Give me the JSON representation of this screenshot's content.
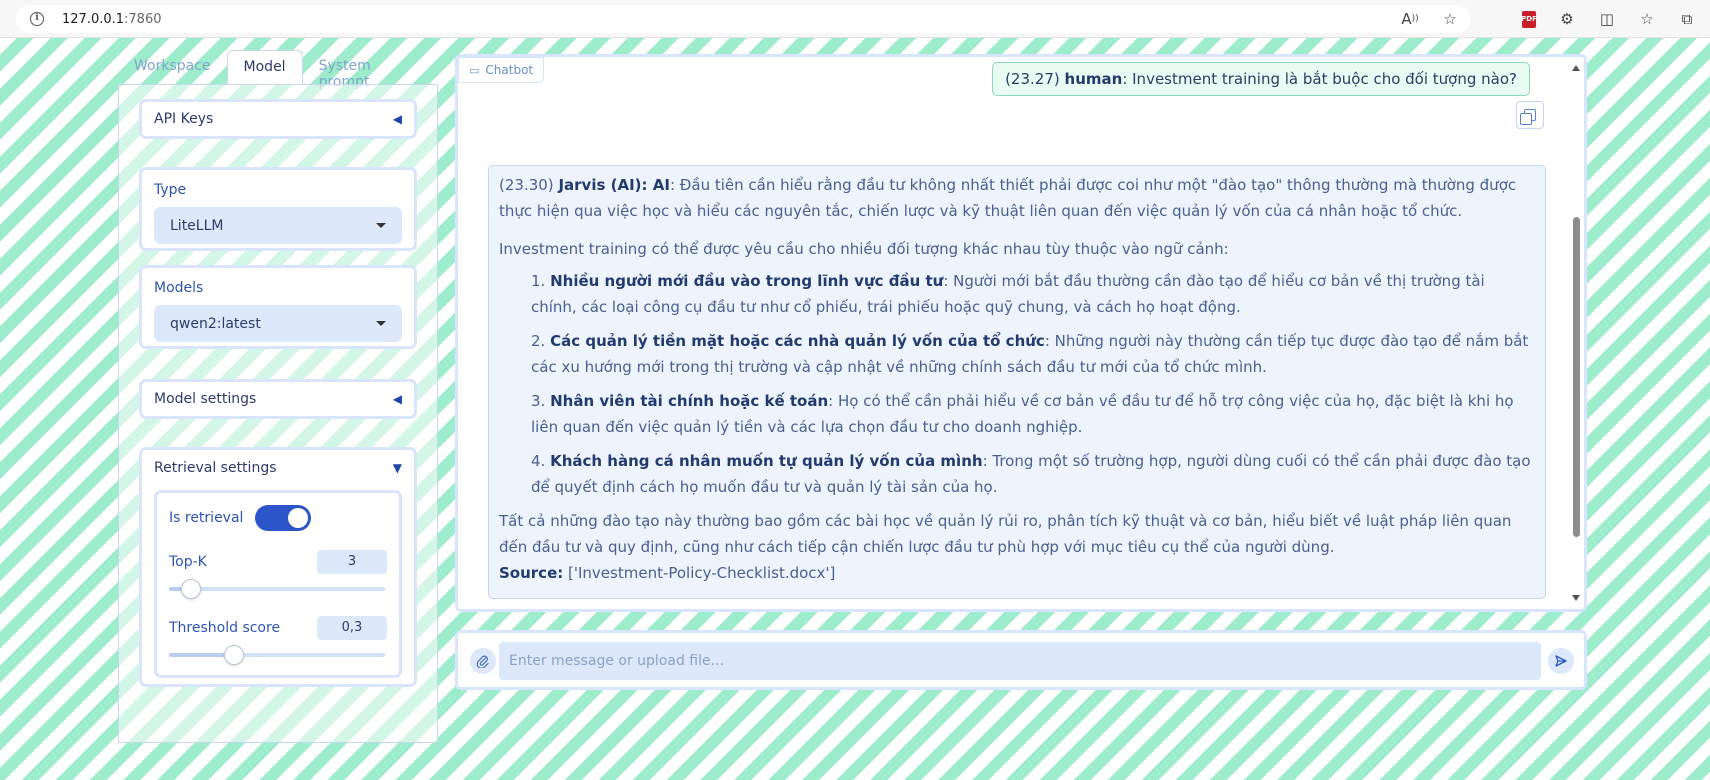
{
  "browser": {
    "url_host": "127.0.0.1",
    "url_port": ":7860"
  },
  "left_panel": {
    "tabs": [
      {
        "label": "Workspace",
        "active": false
      },
      {
        "label": "Model",
        "active": true
      },
      {
        "label": "System prompt",
        "active": false
      }
    ],
    "api_keys": {
      "label": "API Keys",
      "state": "collapsed"
    },
    "type": {
      "label": "Type",
      "value": "LiteLLM"
    },
    "models": {
      "label": "Models",
      "value": "qwen2:latest"
    },
    "model_settings": {
      "label": "Model settings",
      "state": "collapsed"
    },
    "retrieval_settings": {
      "label": "Retrieval settings",
      "state": "expanded",
      "is_retrieval": {
        "label": "Is retrieval",
        "value": true
      },
      "top_k": {
        "label": "Top-K",
        "value": "3",
        "fraction": 0.1
      },
      "threshold": {
        "label": "Threshold score",
        "value": "0,3",
        "fraction": 0.3
      }
    }
  },
  "chat": {
    "label": "Chatbot",
    "human": {
      "time": "(23.27)",
      "speaker": "human",
      "text": ": Investment training là bắt buộc cho đối tượng nào?"
    },
    "ai": {
      "time": "(23.30)",
      "speaker": "Jarvis (AI)",
      "speaker_suffix": ": AI",
      "intro": ": Đầu tiên cần hiểu rằng đầu tư không nhất thiết phải được coi như một \"đào tạo\" thông thường mà thường được thực hiện qua việc học và hiểu các nguyên tắc, chiến lược và kỹ thuật liên quan đến việc quản lý vốn của cá nhân hoặc tổ chức.",
      "lead": "Investment training có thể được yêu cầu cho nhiều đối tượng khác nhau tùy thuộc vào ngữ cảnh:",
      "items": [
        {
          "num": "1.",
          "title": "Nhiều người mới đầu vào trong lĩnh vực đầu tư",
          "text": ": Người mới bắt đầu thường cần đào tạo để hiểu cơ bản về thị trường tài chính, các loại công cụ đầu tư như cổ phiếu, trái phiếu hoặc quỹ chung, và cách họ hoạt động."
        },
        {
          "num": "2.",
          "title": "Các quản lý tiền mặt hoặc các nhà quản lý vốn của tổ chức",
          "text": ": Những người này thường cần tiếp tục được đào tạo để nắm bắt các xu hướng mới trong thị trường và cập nhật về những chính sách đầu tư mới của tổ chức mình."
        },
        {
          "num": "3.",
          "title": "Nhân viên tài chính hoặc kế toán",
          "text": ": Họ có thể cần phải hiểu về cơ bản về đầu tư để hỗ trợ công việc của họ, đặc biệt là khi họ liên quan đến việc quản lý tiền và các lựa chọn đầu tư cho doanh nghiệp."
        },
        {
          "num": "4.",
          "title": "Khách hàng cá nhân muốn tự quản lý vốn của mình",
          "text": ": Trong một số trường hợp, người dùng cuối có thể cần phải được đào tạo để quyết định cách họ muốn đầu tư và quản lý tài sản của họ."
        }
      ],
      "summary": "Tất cả những đào tạo này thường bao gồm các bài học về quản lý rủi ro, phân tích kỹ thuật và cơ bản, hiểu biết về luật pháp liên quan đến đầu tư và quy định, cũng như cách tiếp cận chiến lược đầu tư phù hợp với mục tiêu cụ thể của người dùng.",
      "source_label": "Source:",
      "source_value": " ['Investment-Policy-Checklist.docx']"
    }
  },
  "composer": {
    "placeholder": "Enter message or upload file..."
  }
}
